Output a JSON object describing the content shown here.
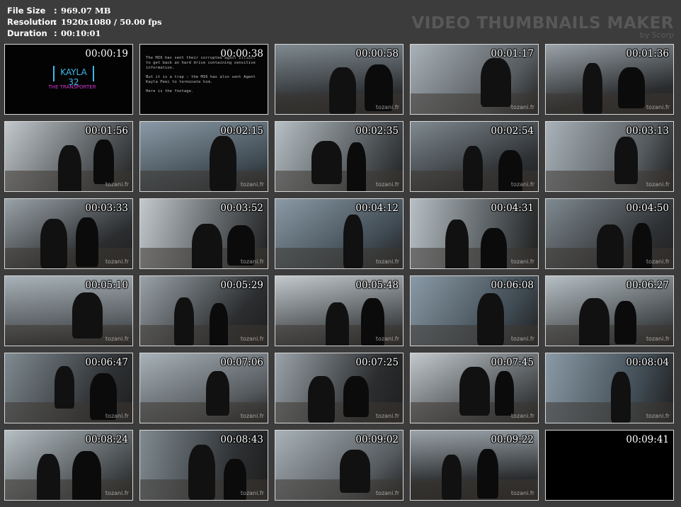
{
  "header": {
    "file_size_label": "File Size",
    "file_size_value": "969.07 MB",
    "resolution_label": "Resolution",
    "resolution_value": "1920x1080 / 50.00 fps",
    "duration_label": "Duration",
    "duration_value": "00:10:01",
    "separator": ":"
  },
  "brand": {
    "title": "VIDEO THUMBNAILS MAKER",
    "subtitle": "by Scorp"
  },
  "intro": {
    "logo": "KAYLA 32",
    "subtitle": "THE TRANSPORTER"
  },
  "brief": {
    "p1": "The MI6 has sent their corrupted agent Elliott to get back an hard drive containing sensitive information.",
    "p2": "But it is a trap : the MI6 has also sent Agent Kayla Peei to terminate him.",
    "p3": "Here is the footage."
  },
  "watermark": "tozani.fr",
  "thumbnails": [
    {
      "time": "00:00:19",
      "scene": "intro"
    },
    {
      "time": "00:00:38",
      "scene": "brief"
    },
    {
      "time": "00:00:58",
      "scene": "room"
    },
    {
      "time": "00:01:17",
      "scene": "room"
    },
    {
      "time": "00:01:36",
      "scene": "room"
    },
    {
      "time": "00:01:56",
      "scene": "room"
    },
    {
      "time": "00:02:15",
      "scene": "room"
    },
    {
      "time": "00:02:35",
      "scene": "room"
    },
    {
      "time": "00:02:54",
      "scene": "room"
    },
    {
      "time": "00:03:13",
      "scene": "room"
    },
    {
      "time": "00:03:33",
      "scene": "room"
    },
    {
      "time": "00:03:52",
      "scene": "room"
    },
    {
      "time": "00:04:12",
      "scene": "room"
    },
    {
      "time": "00:04:31",
      "scene": "room"
    },
    {
      "time": "00:04:50",
      "scene": "room"
    },
    {
      "time": "00:05:10",
      "scene": "room"
    },
    {
      "time": "00:05:29",
      "scene": "room"
    },
    {
      "time": "00:05:48",
      "scene": "room"
    },
    {
      "time": "00:06:08",
      "scene": "room"
    },
    {
      "time": "00:06:27",
      "scene": "room"
    },
    {
      "time": "00:06:47",
      "scene": "room"
    },
    {
      "time": "00:07:06",
      "scene": "room"
    },
    {
      "time": "00:07:25",
      "scene": "room"
    },
    {
      "time": "00:07:45",
      "scene": "room"
    },
    {
      "time": "00:08:04",
      "scene": "room"
    },
    {
      "time": "00:08:24",
      "scene": "room"
    },
    {
      "time": "00:08:43",
      "scene": "room"
    },
    {
      "time": "00:09:02",
      "scene": "room"
    },
    {
      "time": "00:09:22",
      "scene": "room"
    },
    {
      "time": "00:09:41",
      "scene": "blank"
    }
  ]
}
